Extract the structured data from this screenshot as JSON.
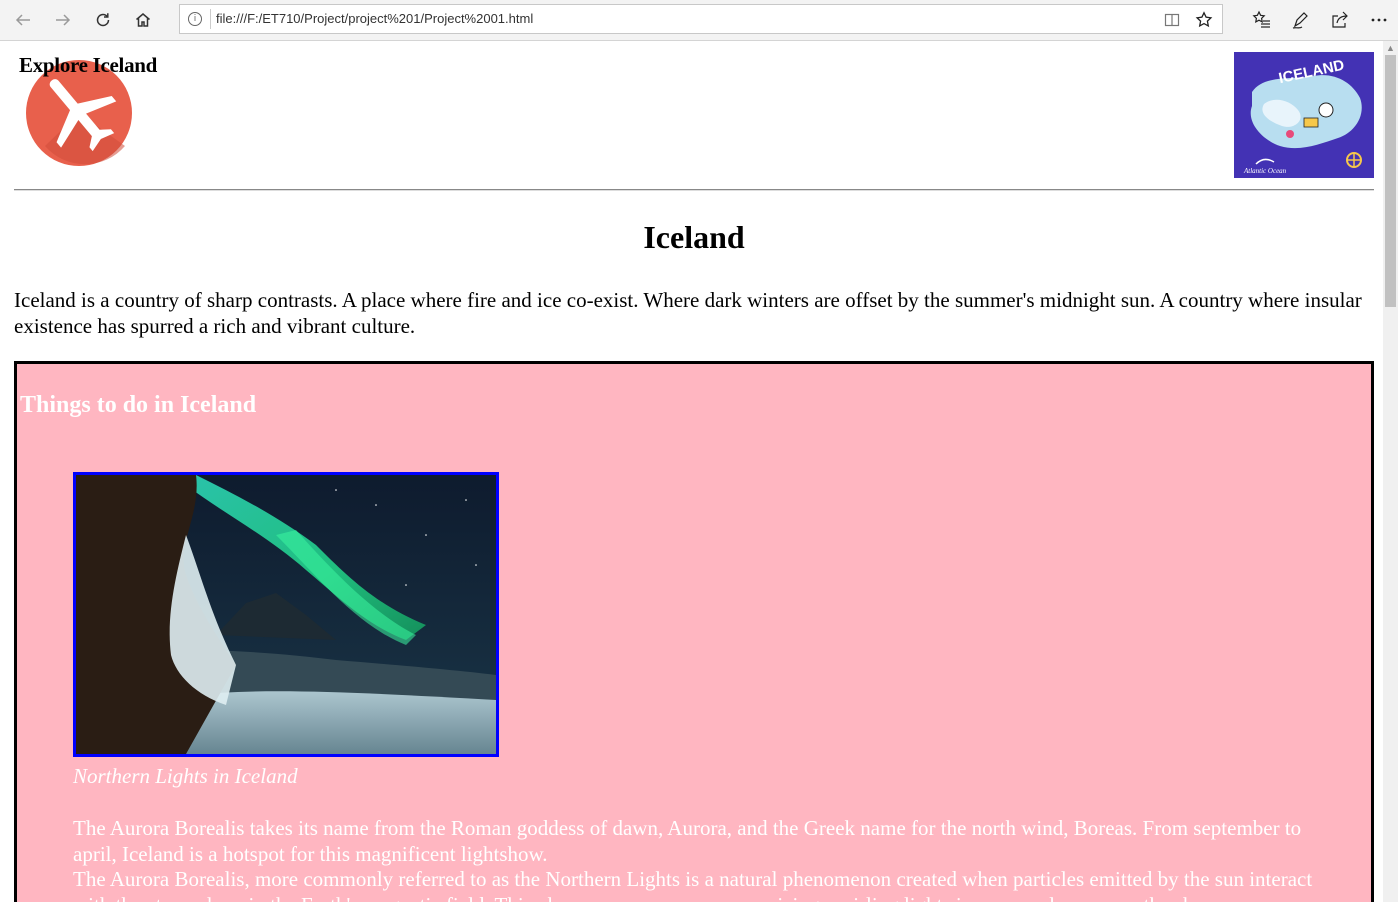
{
  "browser": {
    "url": "file:///F:/ET710/Project/project%201/Project%2001.html",
    "nav": {
      "back_icon": "back-arrow-icon",
      "forward_icon": "forward-arrow-icon",
      "refresh_icon": "refresh-icon",
      "home_icon": "home-icon"
    },
    "toolbar_icons": [
      "reading-view-icon",
      "favorite-star-icon",
      "favorites-list-icon",
      "pen-icon",
      "share-icon",
      "more-icon"
    ]
  },
  "header": {
    "brand_title": "Explore Iceland",
    "logo_icon": "airplane-logo-icon",
    "map_image": "iceland-map-image",
    "map_title": "ICELAND",
    "map_subtitle": "Atlantic Ocean",
    "logo_color": "#e8604c"
  },
  "main": {
    "heading": "Iceland",
    "intro": "Iceland is a country of sharp contrasts. A place where fire and ice co-exist. Where dark winters are offset by the summer's midnight sun. A country where insular existence has spurred a rich and vibrant culture."
  },
  "things_to_do": {
    "heading": "Things to do in Iceland",
    "background_color": "#ffb6c1",
    "image": "northern-lights-photo",
    "caption": "Northern Lights in Iceland",
    "paragraph_1": "The Aurora Borealis takes its name from the Roman goddess of dawn, Aurora, and the Greek name for the north wind, Boreas. From september to april, Iceland is a hotspot for this magnificent lightshow.",
    "paragraph_2": "The Aurora Borealis, more commonly referred to as the Northern Lights is a natural phenomenon created when particles emitted by the sun interact with the atmosphere in the Earth's magnetic field. This phenomenon causes mesmerizing, swirling lights in many colors across the sky."
  }
}
